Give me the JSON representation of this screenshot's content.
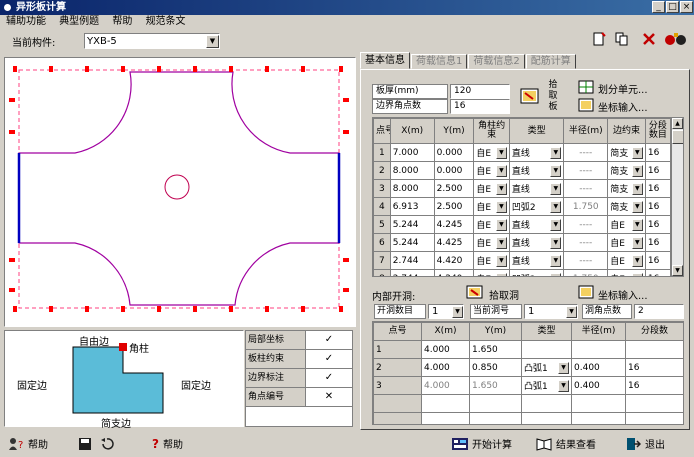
{
  "window": {
    "title": "异形板计算"
  },
  "menu": [
    "辅助功能",
    "典型例题",
    "帮助",
    "规范条文"
  ],
  "component": {
    "label": "当前构件:",
    "value": "YXB-5"
  },
  "tabs": [
    "基本信息",
    "荷载信息1",
    "荷载信息2",
    "配筋计算"
  ],
  "basic": {
    "thickness_label": "板厚(mm)",
    "thickness_value": "120",
    "corner_label": "边界角点数",
    "corner_value": "16",
    "pick_label": "拾取板",
    "divide_label": "划分单元...",
    "coord_label": "坐标输入..."
  },
  "vertex_table": {
    "headers": [
      "点号",
      "X(m)",
      "Y(m)",
      "角柱约束",
      "类型",
      "半径(m)",
      "边约束",
      "分段数目"
    ],
    "rows": [
      {
        "no": "1",
        "x": "7.000",
        "y": "0.000",
        "col": "自E",
        "type": "直线",
        "r": "----",
        "edge": "简支",
        "seg": "16"
      },
      {
        "no": "2",
        "x": "8.000",
        "y": "0.000",
        "col": "自E",
        "type": "直线",
        "r": "----",
        "edge": "简支",
        "seg": "16"
      },
      {
        "no": "3",
        "x": "8.000",
        "y": "2.500",
        "col": "自E",
        "type": "直线",
        "r": "----",
        "edge": "简支",
        "seg": "16"
      },
      {
        "no": "4",
        "x": "6.913",
        "y": "2.500",
        "col": "自E",
        "type": "凹弧2",
        "r": "1.750",
        "edge": "简支",
        "seg": "16"
      },
      {
        "no": "5",
        "x": "5.244",
        "y": "4.245",
        "col": "自E",
        "type": "直线",
        "r": "----",
        "edge": "自E",
        "seg": "16"
      },
      {
        "no": "6",
        "x": "5.244",
        "y": "4.425",
        "col": "自E",
        "type": "直线",
        "r": "----",
        "edge": "自E",
        "seg": "16"
      },
      {
        "no": "7",
        "x": "2.744",
        "y": "4.420",
        "col": "自E",
        "type": "直线",
        "r": "----",
        "edge": "自E",
        "seg": "16"
      },
      {
        "no": "8",
        "x": "2.744",
        "y": "4.240",
        "col": "自E",
        "type": "凹弧2",
        "r": "1.750",
        "edge": "自E",
        "seg": "16"
      }
    ]
  },
  "openings": {
    "label": "内部开洞:",
    "pick_label": "拾取洞",
    "coord_label": "坐标输入...",
    "count_label": "开洞数目",
    "count_value": "1",
    "current_label": "当前洞号",
    "current_value": "1",
    "points_label": "洞角点数",
    "points_value": "2",
    "headers": [
      "点号",
      "X(m)",
      "Y(m)",
      "类型",
      "半径(m)",
      "分段数"
    ],
    "rows": [
      {
        "no": "1",
        "x": "4.000",
        "y": "1.650",
        "type": "",
        "r": "",
        "seg": ""
      },
      {
        "no": "2",
        "x": "4.000",
        "y": "0.850",
        "type": "凸弧1",
        "r": "0.400",
        "seg": "16"
      },
      {
        "no": "3",
        "x": "4.000",
        "y": "1.650",
        "type": "凸弧1",
        "r": "0.400",
        "seg": "16"
      }
    ]
  },
  "legend": {
    "free": "自由边",
    "corner": "角柱",
    "fixed_left": "固定边",
    "fixed_right": "固定边",
    "simple": "简支边"
  },
  "flags": [
    {
      "label": "局部坐标",
      "value": "✓"
    },
    {
      "label": "板柱约束",
      "value": "✓"
    },
    {
      "label": "边界标注",
      "value": "✓"
    },
    {
      "label": "角点编号",
      "value": "✕"
    }
  ],
  "status": {
    "help_left": "帮助",
    "help": "帮助",
    "calc": "开始计算",
    "results": "结果查看",
    "exit": "退出"
  },
  "colors": {
    "boundary": "#c00050",
    "hole": "#c00050",
    "support": "#ff0000",
    "fill": "#5bbcd8",
    "titlebar": "#0a246a"
  }
}
